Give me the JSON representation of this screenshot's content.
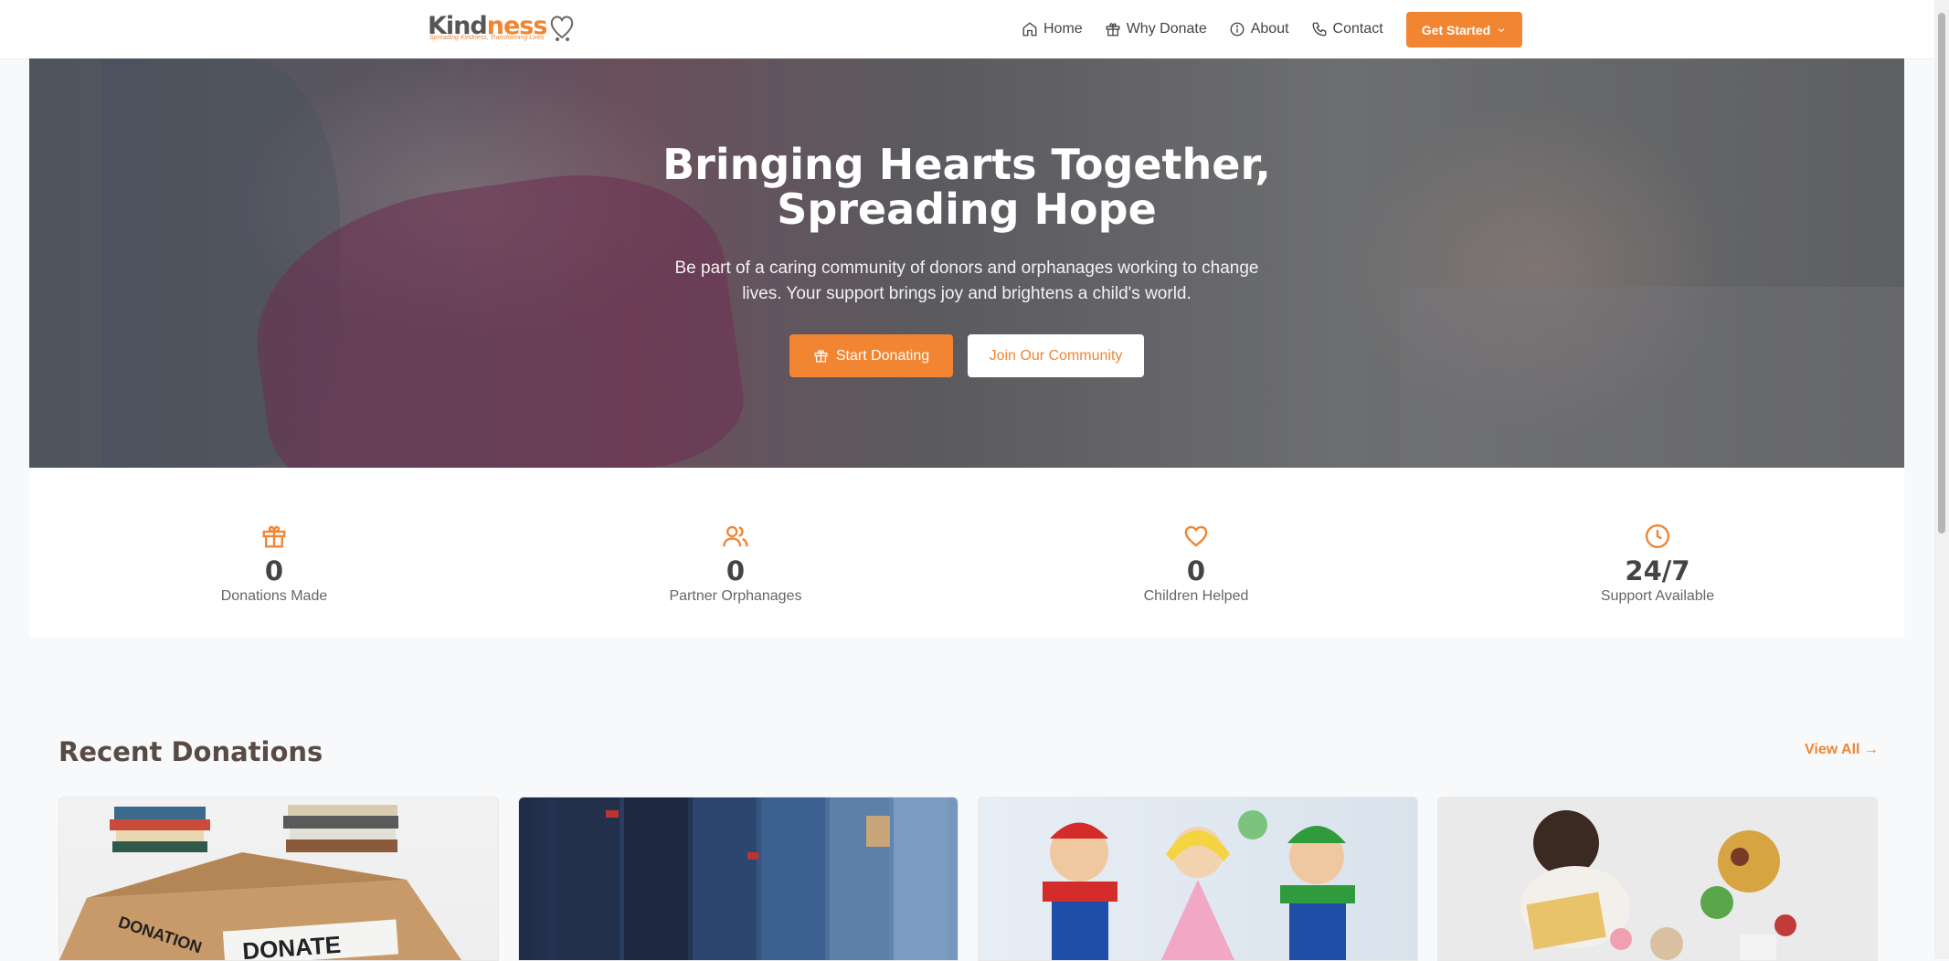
{
  "nav": {
    "logo_main": "Kind",
    "logo_accent": "ness",
    "logo_tagline": "Spreading Kindness, Transforming Lives",
    "links": [
      {
        "label": "Home",
        "icon": "home-icon"
      },
      {
        "label": "Why Donate",
        "icon": "gift-icon"
      },
      {
        "label": "About",
        "icon": "info-icon"
      },
      {
        "label": "Contact",
        "icon": "phone-icon"
      }
    ],
    "cta_label": "Get Started"
  },
  "hero": {
    "title_line1": "Bringing Hearts Together,",
    "title_line2": "Spreading Hope",
    "subtitle": "Be part of a caring community of donors and orphanages working to change lives. Your support brings joy and brightens a child's world.",
    "primary_button": "Start Donating",
    "secondary_button": "Join Our Community"
  },
  "stats": [
    {
      "value": "0",
      "label": "Donations Made",
      "icon": "gift-icon"
    },
    {
      "value": "0",
      "label": "Partner Orphanages",
      "icon": "users-icon"
    },
    {
      "value": "0",
      "label": "Children Helped",
      "icon": "heart-icon"
    },
    {
      "value": "24/7",
      "label": "Support Available",
      "icon": "clock-icon"
    }
  ],
  "recent": {
    "title": "Recent Donations",
    "view_all": "View All →",
    "card_text_1": "DONATE",
    "card_text_2": "DONATION"
  },
  "colors": {
    "accent": "#f28532",
    "heading": "#5a4a44"
  }
}
